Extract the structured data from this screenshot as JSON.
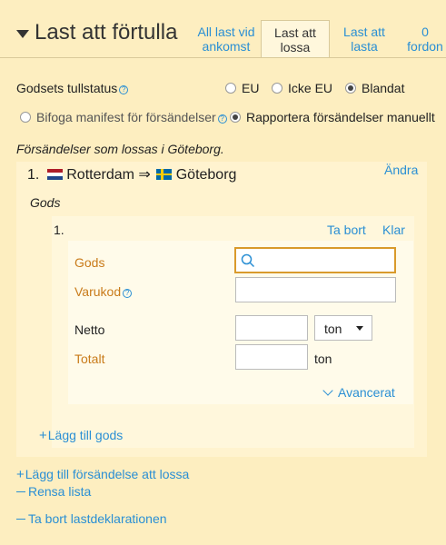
{
  "header": {
    "title": "Last att förtulla",
    "tabs": [
      {
        "line1": "All last vid",
        "line2": "ankomst"
      },
      {
        "line1": "Last att",
        "line2": "lossa"
      },
      {
        "line1": "Last att",
        "line2": "lasta"
      },
      {
        "line1": "0",
        "line2": "fordon"
      }
    ]
  },
  "customs": {
    "label": "Godsets tullstatus",
    "options": [
      "EU",
      "Icke EU",
      "Blandat"
    ],
    "selected": "Blandat"
  },
  "manifest": {
    "option1": "Bifoga manifest för försändelser",
    "option2": "Rapportera försändelser manuellt",
    "selected": "Rapportera försändelser manuellt"
  },
  "shipments_heading": "Försändelser som lossas i Göteborg.",
  "shipment": {
    "number": "1.",
    "from": "Rotterdam",
    "arrow": "⇒",
    "to": "Göteborg",
    "edit": "Ändra",
    "goods_heading": "Gods",
    "goods_item": {
      "number": "1.",
      "remove": "Ta bort",
      "done": "Klar",
      "gods_label": "Gods",
      "gods_value": "",
      "varukod_label": "Varukod",
      "varukod_value": "",
      "netto_label": "Netto",
      "netto_value": "",
      "netto_unit": "ton",
      "totalt_label": "Totalt",
      "totalt_value": "",
      "totalt_unit": "ton",
      "advanced": "Avancerat"
    },
    "add_goods": "Lägg till gods"
  },
  "actions": {
    "add_shipment": "Lägg till försändelse att lossa",
    "clear_list": "Rensa lista",
    "remove_declaration": "Ta bort lastdeklarationen"
  },
  "colors": {
    "background": "#fdeec0",
    "link": "#2a8fd4",
    "orange_label": "#c97b1a"
  }
}
